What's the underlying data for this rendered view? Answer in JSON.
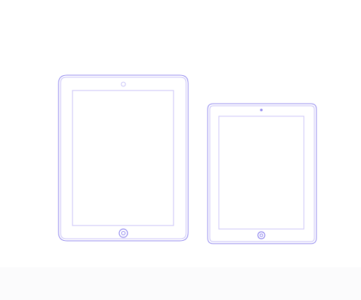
{
  "colors": {
    "outline": "#8f86ee",
    "outline_light": "#c8c2f7",
    "background": "#ffffff",
    "bottom_band": "#fbfbfc"
  },
  "icons": {
    "large_tablet": "tablet-outline-icon",
    "small_tablet": "tablet-outline-icon",
    "large_camera": "camera-icon",
    "small_camera": "camera-icon",
    "large_home_button": "home-button-icon",
    "small_home_button": "home-button-icon"
  }
}
